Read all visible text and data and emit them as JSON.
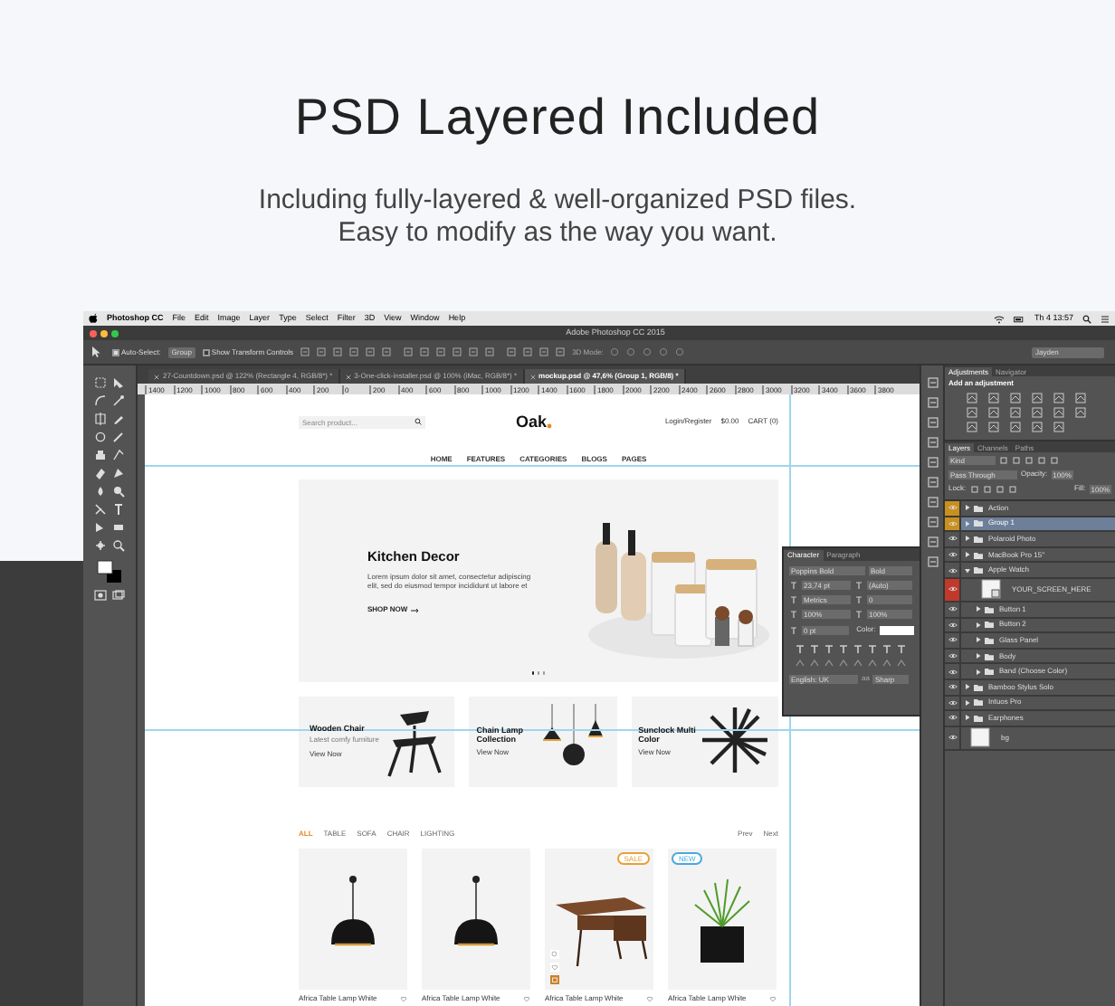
{
  "heading": "PSD Layered Included",
  "subtitle": [
    "Including fully-layered & well-organized PSD files.",
    "Easy to modify as the way you want."
  ],
  "menubar": {
    "app": "Photoshop CC",
    "items": [
      "File",
      "Edit",
      "Image",
      "Layer",
      "Type",
      "Select",
      "Filter",
      "3D",
      "View",
      "Window",
      "Help"
    ],
    "clock": "Th 4 13:57"
  },
  "window": {
    "title": "Adobe Photoshop CC 2015"
  },
  "options_bar": {
    "auto_select": {
      "label": "Auto-Select:",
      "checked": true
    },
    "auto_select_target": "Group",
    "transform_controls": {
      "label": "Show Transform Controls",
      "checked": false
    },
    "mode_label": "3D Mode:",
    "workspace": "Jayden"
  },
  "document_tabs": [
    {
      "label": "27-Countdown.psd @ 122% (Rectangle 4, RGB/8*) *",
      "selected": false
    },
    {
      "label": "3-One-click-installer.psd @ 100% (iMac, RGB/8*) *",
      "selected": false
    },
    {
      "label": "mockup.psd @ 47,6% (Group 1, RGB/8) *",
      "selected": true
    }
  ],
  "ruler": [
    "1400",
    "1200",
    "1000",
    "800",
    "600",
    "400",
    "200",
    "0",
    "200",
    "400",
    "600",
    "800",
    "1000",
    "1200",
    "1400",
    "1600",
    "1800",
    "2000",
    "2200",
    "2400",
    "2600",
    "2800",
    "3000",
    "3200",
    "3400",
    "3600",
    "3800"
  ],
  "site": {
    "search": {
      "placeholder": "Search product..."
    },
    "logo": "Oak",
    "header_links": [
      "Login/Register",
      "$0.00",
      "CART (0)"
    ],
    "nav": [
      "HOME",
      "FEATURES",
      "CATEGORIES",
      "BLOGS",
      "PAGES"
    ],
    "hero": {
      "title": "Kitchen Decor",
      "text": "Lorem ipsum dolor sit amet, consectetur adipiscing elit, sed do eiusmod tempor incididunt ut labore et",
      "button": "SHOP NOW",
      "dots": [
        {
          "selected": true
        },
        {
          "selected": false
        },
        {
          "selected": false
        }
      ]
    },
    "promos": [
      {
        "kind": "chair",
        "title": "Wooden Chair",
        "subtitle": "Latest comfy furniture",
        "link": "View Now"
      },
      {
        "kind": "lamps",
        "title": "Chain Lamp Collection",
        "link": "View Now"
      },
      {
        "kind": "clock",
        "title": "Sunclock Multi Color",
        "link": "View Now"
      }
    ],
    "filters": [
      {
        "label": "ALL",
        "selected": true
      },
      {
        "label": "TABLE",
        "selected": false
      },
      {
        "label": "SOFA",
        "selected": false
      },
      {
        "label": "CHAIR",
        "selected": false
      },
      {
        "label": "LIGHTING",
        "selected": false
      }
    ],
    "pager": [
      "Prev",
      "Next"
    ],
    "products": [
      {
        "kind": "lamp",
        "name": "Africa Table Lamp White"
      },
      {
        "kind": "lamp",
        "name": "Africa Table Lamp White"
      },
      {
        "kind": "desk",
        "name": "Africa Table Lamp White",
        "badge": {
          "text": "SALE",
          "color": "#e8a13a"
        },
        "hovered": true
      },
      {
        "kind": "plant",
        "name": "Africa Table Lamp White",
        "badge": {
          "text": "NEW",
          "color": "#4aa8e0"
        }
      }
    ]
  },
  "character_panel": {
    "tabs": [
      {
        "label": "Character",
        "selected": true
      },
      {
        "label": "Paragraph",
        "selected": false
      }
    ],
    "font": "Poppins Bold",
    "style": "Bold",
    "size": "23,74 pt",
    "leading": "(Auto)",
    "kerning": "Metrics",
    "tracking": "0",
    "vscale": "100%",
    "hscale": "100%",
    "baseline": "0 pt",
    "color_label": "Color:",
    "language": "English: UK",
    "aa_label": "aa",
    "antialias": "Sharp"
  },
  "adjustments": {
    "tabs": [
      {
        "label": "Adjustments",
        "selected": true
      },
      {
        "label": "Navigator",
        "selected": false
      }
    ],
    "hint": "Add an adjustment"
  },
  "layers_panel": {
    "tabs": [
      {
        "label": "Layers",
        "selected": true
      },
      {
        "label": "Channels",
        "selected": false
      },
      {
        "label": "Paths",
        "selected": false
      }
    ],
    "filter": "Kind",
    "blend": "Pass Through",
    "opacity_label": "Opacity:",
    "opacity": "100%",
    "lock_label": "Lock:",
    "fill_label": "Fill:",
    "fill": "100%",
    "layers": [
      {
        "name": "Action",
        "kind": "group",
        "selected": false,
        "expanded": false,
        "color": "#c8901e"
      },
      {
        "name": "Group 1",
        "kind": "group",
        "selected": true,
        "expanded": false,
        "color": "#c8901e"
      },
      {
        "name": "Polaroid Photo",
        "kind": "group",
        "selected": false,
        "expanded": false
      },
      {
        "name": "MacBook Pro 15\"",
        "kind": "group",
        "selected": false,
        "expanded": false
      },
      {
        "name": "Apple Watch",
        "kind": "group",
        "selected": false,
        "expanded": true,
        "children": [
          {
            "name": "YOUR_SCREEN_HERE",
            "kind": "smart",
            "selected": false,
            "color": "#c0392b"
          },
          {
            "name": "Button 1",
            "kind": "group",
            "selected": false,
            "expanded": false
          },
          {
            "name": "Button 2",
            "kind": "group",
            "selected": false,
            "expanded": false
          },
          {
            "name": "Glass Panel",
            "kind": "group",
            "selected": false,
            "expanded": false
          },
          {
            "name": "Body",
            "kind": "group",
            "selected": false,
            "expanded": false
          },
          {
            "name": "Band (Choose Color)",
            "kind": "group",
            "selected": false,
            "expanded": false
          }
        ]
      },
      {
        "name": "Bamboo Stylus Solo",
        "kind": "group",
        "selected": false,
        "expanded": false
      },
      {
        "name": "Intuos Pro",
        "kind": "group",
        "selected": false,
        "expanded": false
      },
      {
        "name": "Earphones",
        "kind": "group",
        "selected": false,
        "expanded": false
      },
      {
        "name": "bg",
        "kind": "layer",
        "selected": false
      }
    ]
  }
}
